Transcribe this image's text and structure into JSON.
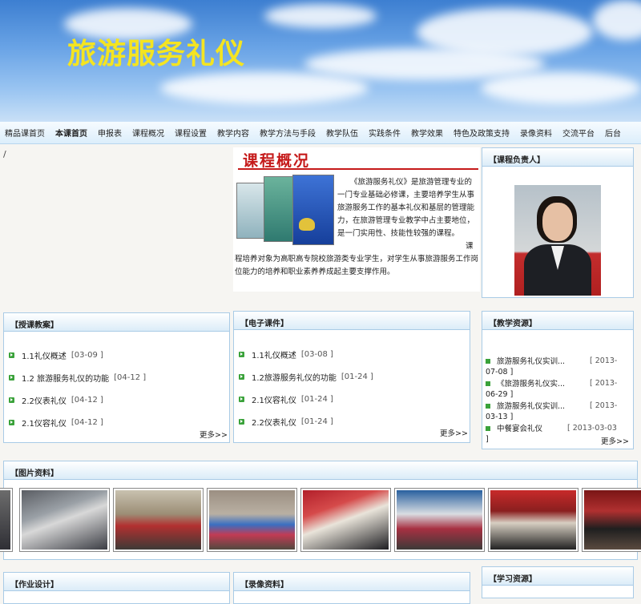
{
  "banner": {
    "title": "旅游服务礼仪"
  },
  "nav": [
    "精品课首页",
    "本课首页",
    "申报表",
    "课程概况",
    "课程设置",
    "教学内容",
    "教学方法与手段",
    "教学队伍",
    "实践条件",
    "教学效果",
    "特色及政策支持",
    "录像资料",
    "交流平台",
    "后台"
  ],
  "breadcrumb": "/",
  "overview": {
    "title": "课程概况",
    "paragraph1": "《旅游服务礼仪》是旅游管理专业的一门专业基础必修课，主要培养学生从事旅游服务工作的基本礼仪和基层的管理能力，在旅游管理专业教学中占主要地位，是一门实用性、技能性较强的课程。",
    "paragraph2": "课程培养对象为高职高专院校旅游类专业学生，对学生从事旅游服务工作岗位能力的培养和职业素养养成起主要支撑作用。"
  },
  "leader": {
    "title": "【课程负责人】"
  },
  "lesson_plans": {
    "title": "【授课教案】",
    "items": [
      {
        "label": "1.1礼仪概述",
        "date": "[03-09 ]"
      },
      {
        "label": "1.2 旅游服务礼仪的功能",
        "date": "[04-12 ]"
      },
      {
        "label": "2.2仪表礼仪",
        "date": "[04-12 ]"
      },
      {
        "label": "2.1仪容礼仪",
        "date": "[04-12 ]"
      }
    ],
    "more": "更多>>"
  },
  "courseware": {
    "title": "【电子课件】",
    "items": [
      {
        "label": "1.1礼仪概述",
        "date": "[03-08 ]"
      },
      {
        "label": "1.2旅游服务礼仪的功能",
        "date": "[01-24 ]"
      },
      {
        "label": "2.1仪容礼仪",
        "date": "[01-24 ]"
      },
      {
        "label": "2.2仪表礼仪",
        "date": "[01-24 ]"
      }
    ],
    "more": "更多>>"
  },
  "teaching_resources": {
    "title": "【教学资源】",
    "items": [
      {
        "label": "旅游服务礼仪实训...",
        "date1": "[ 2013-",
        "date2": "07-08 ]"
      },
      {
        "label": "《旅游服务礼仪实...",
        "date1": "[ 2013-",
        "date2": "06-29 ]"
      },
      {
        "label": "旅游服务礼仪实训...",
        "date1": "[ 2013-",
        "date2": "03-13 ]"
      },
      {
        "label": "中餐宴会礼仪",
        "date1": "[ 2013-03-03",
        "date2": "]"
      }
    ],
    "more": "更多>>"
  },
  "photos": {
    "title": "【图片资料】"
  },
  "homework": {
    "title": "【作业设计】"
  },
  "videos": {
    "title": "【录像资料】"
  },
  "learning_resources": {
    "title": "【学习资源】"
  },
  "colors": {
    "accent_red": "#c51a1a",
    "title_yellow": "#f4e421",
    "bullet_green": "#3aa23a",
    "panel_border": "#a9cbe6"
  }
}
